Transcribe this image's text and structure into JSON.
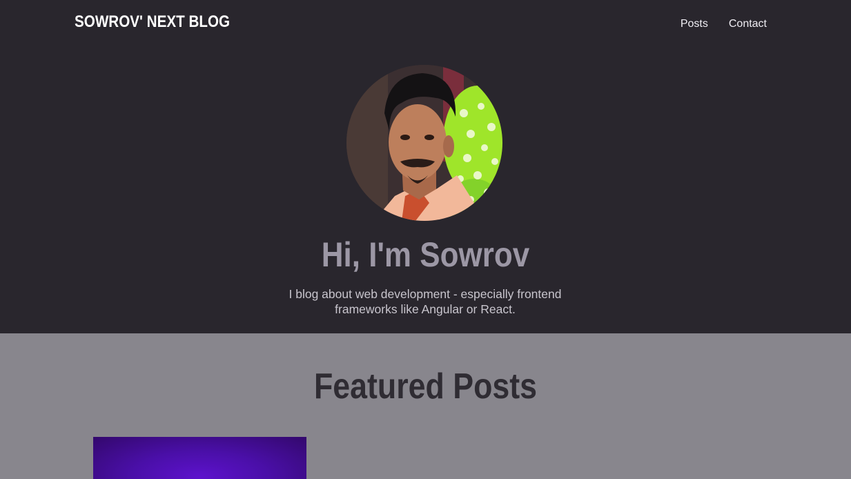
{
  "header": {
    "logo": "SOWROV' NEXT BLOG",
    "nav": [
      {
        "label": "Posts"
      },
      {
        "label": "Contact"
      }
    ]
  },
  "hero": {
    "title": "Hi, I'm Sowrov",
    "description": "I blog about web development - especially frontend frameworks like Angular or React."
  },
  "featured": {
    "title": "Featured Posts"
  },
  "colors": {
    "header_bg": "#29262d",
    "section_bg": "#88868d",
    "accent_purple": "#5d12cc"
  }
}
